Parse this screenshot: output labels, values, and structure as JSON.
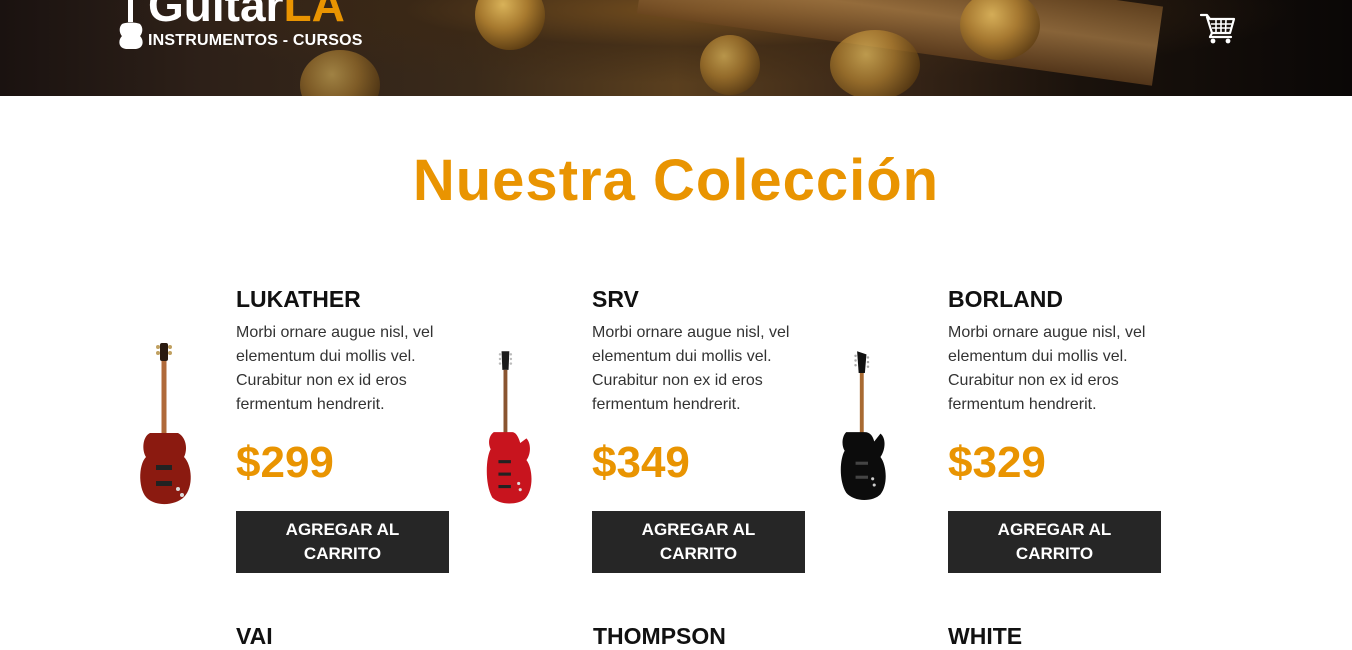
{
  "header": {
    "logo": {
      "word": "Guitar",
      "accent": "LA",
      "subtitle": "INSTRUMENTOS - CURSOS"
    },
    "cart_icon": "cart-icon"
  },
  "main": {
    "heading": "Nuestra Colección",
    "products": [
      {
        "name": "LUKATHER",
        "description": "Morbi ornare augue nisl, vel elementum dui mollis vel. Curabitur non ex id eros fermentum hendrerit.",
        "price": "$299",
        "button_label": "Agregar al Carrito",
        "guitar_color": "#8b1a10"
      },
      {
        "name": "SRV",
        "description": "Morbi ornare augue nisl, vel elementum dui mollis vel. Curabitur non ex id eros fermentum hendrerit.",
        "price": "$349",
        "button_label": "Agregar al Carrito",
        "guitar_color": "#c8141e"
      },
      {
        "name": "BORLAND",
        "description": "Morbi ornare augue nisl, vel elementum dui mollis vel. Curabitur non ex id eros fermentum hendrerit.",
        "price": "$329",
        "button_label": "Agregar al Carrito",
        "guitar_color": "#0c0c0c"
      }
    ],
    "next_row": [
      {
        "name": "VAI"
      },
      {
        "name": "THOMPSON"
      },
      {
        "name": "WHITE"
      }
    ]
  },
  "colors": {
    "accent": "#e99401",
    "button_bg": "#262626",
    "text": "#111111"
  }
}
